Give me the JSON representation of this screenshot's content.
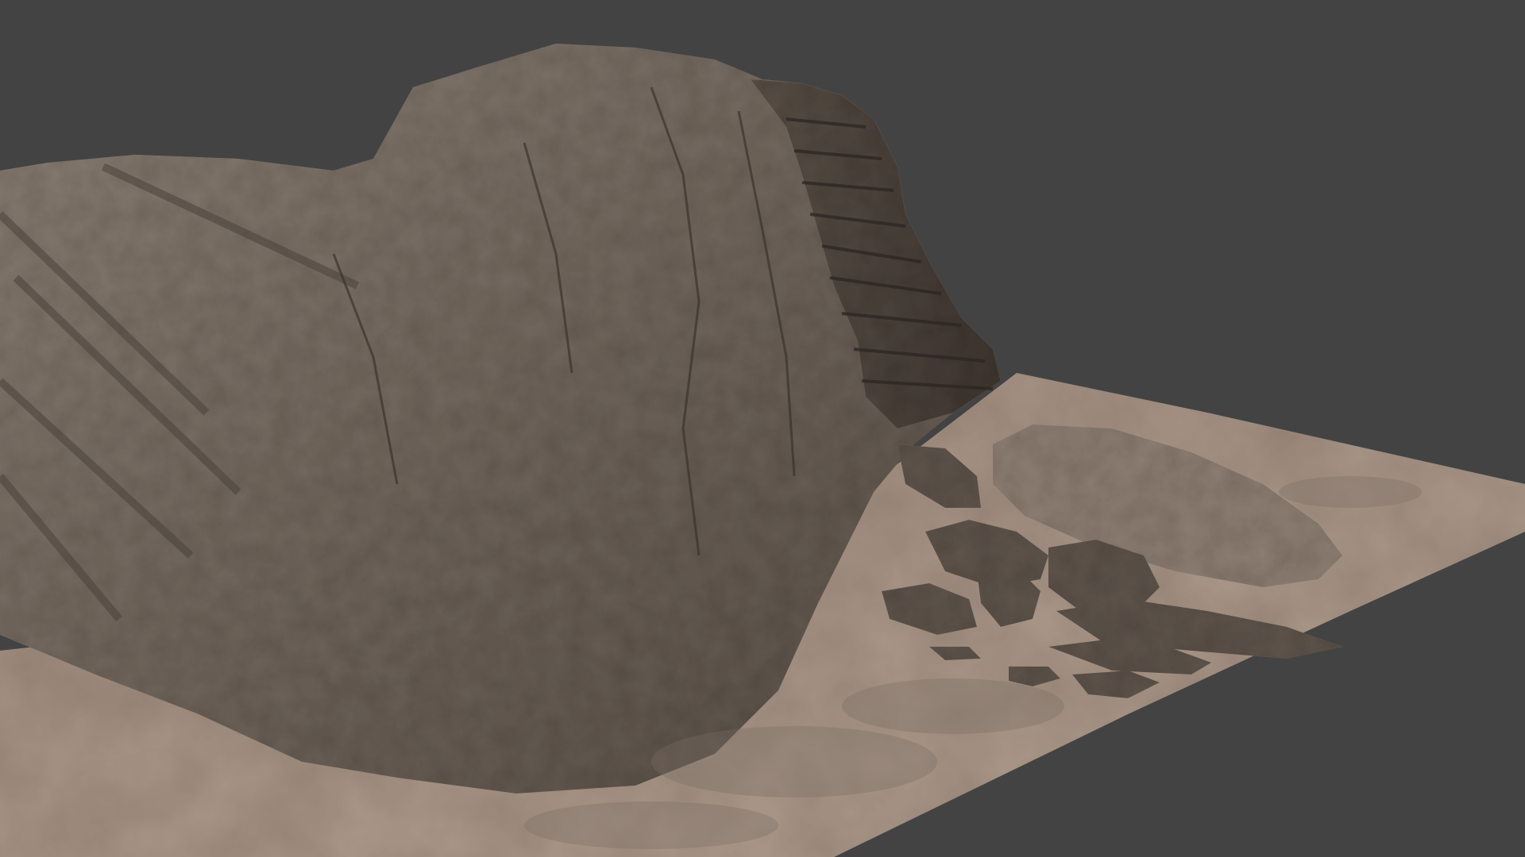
{
  "scene": {
    "subject": "rock-cliff-3d-model",
    "viewport_background_color": "#434343",
    "colors": {
      "ground_sand": "#a59283",
      "ground_dark": "#7c6f65",
      "rock_light": "#857a70",
      "rock_mid": "#6e645b",
      "rock_dark": "#3f3731",
      "rock_shadow": "#2e2824"
    }
  }
}
